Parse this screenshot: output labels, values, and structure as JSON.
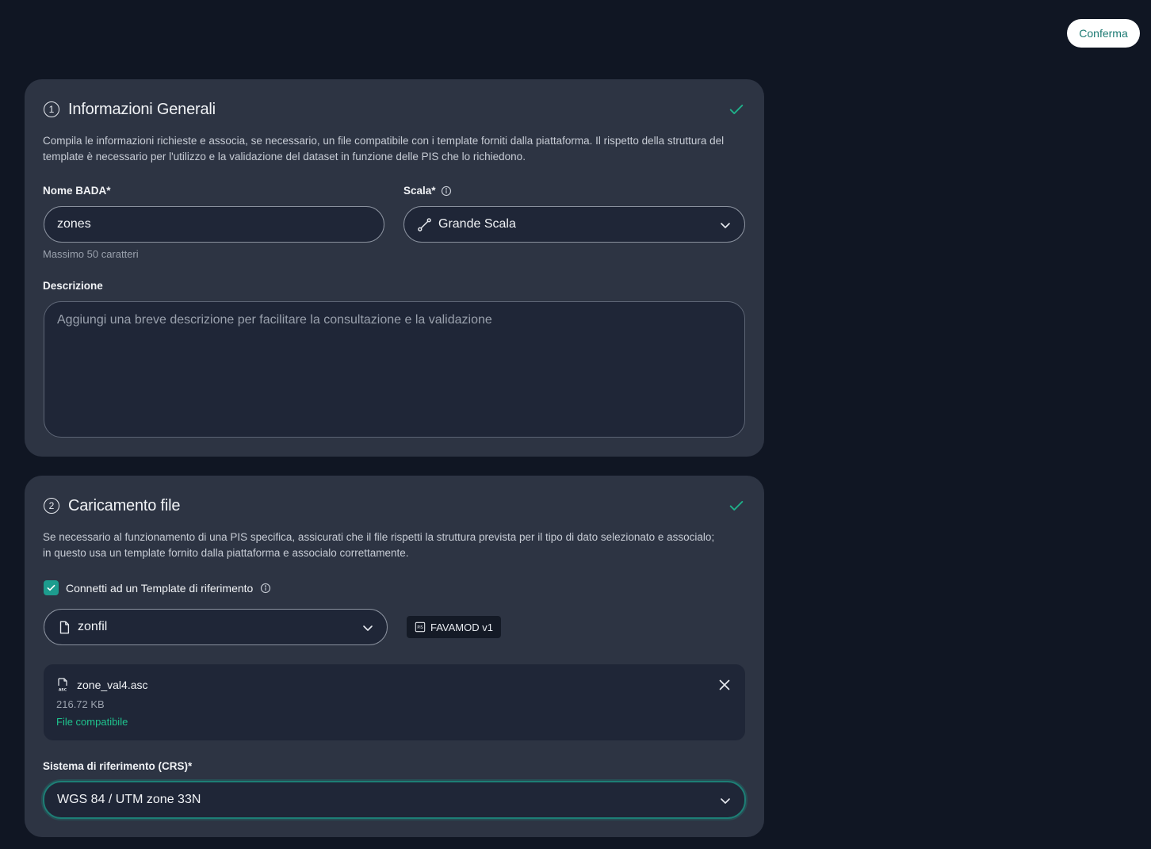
{
  "header": {
    "confirm_label": "Conferma"
  },
  "section1": {
    "step": "1",
    "title": "Informazioni Generali",
    "description": "Compila le informazioni richieste e associa, se necessario, un file compatibile con i template forniti dalla piattaforma. Il rispetto della struttura del template è necessario per l'utilizzo e la validazione del dataset in funzione delle PIS che lo richiedono.",
    "name_label": "Nome BADA*",
    "name_value": "zones",
    "name_helper": "Massimo 50 caratteri",
    "scale_label": "Scala*",
    "scale_value": "Grande Scala",
    "description_label": "Descrizione",
    "description_placeholder": "Aggiungi una breve descrizione per facilitare la consultazione e la validazione"
  },
  "section2": {
    "step": "2",
    "title": "Caricamento file",
    "description": "Se necessario al funzionamento di una PIS specifica, assicurati che il file rispetti la struttura prevista per il tipo di dato selezionato e associalo; in questo usa un template fornito dalla piattaforma e associalo correttamente.",
    "template_checkbox_label": "Connetti ad un Template di riferimento",
    "template_value": "zonfil",
    "pis_badge": "FAVAMOD v1",
    "file": {
      "name": "zone_val4.asc",
      "size": "216.72 KB",
      "status": "File compatibile"
    },
    "crs_label": "Sistema di riferimento (CRS)*",
    "crs_value": "WGS 84 / UTM zone 33N"
  },
  "colors": {
    "background": "#101623",
    "card": "#2d3443",
    "accent": "#1d9c8e",
    "success": "#1fc48e"
  }
}
